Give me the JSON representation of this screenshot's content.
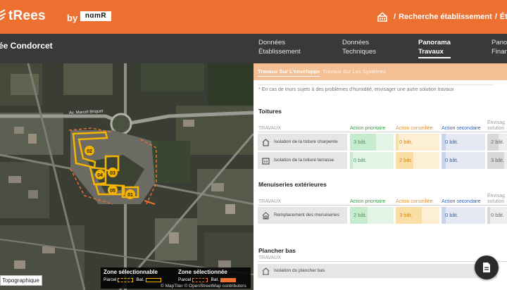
{
  "header": {
    "logo": "tRees",
    "by": "by",
    "partner": "nɑmR",
    "breadcrumb": [
      "Recherche établissement",
      "Établiss"
    ],
    "separators": [
      "/",
      "/"
    ]
  },
  "titlebar": {
    "title": "ée Condorcet",
    "tabs": [
      {
        "line1": "Données",
        "line2": "Établissement"
      },
      {
        "line1": "Données",
        "line2": "Techniques"
      },
      {
        "line1": "Panorama",
        "line2": "Travaux",
        "active": true
      },
      {
        "line1": "Panor",
        "line2": "Finan"
      }
    ]
  },
  "map": {
    "street_label": "Av. Marcel Briquet",
    "markers": [
      "02",
      "03",
      "04",
      "05",
      "01"
    ],
    "topo_button": "Topographique",
    "legend": {
      "selected_zone_1": {
        "title": "Zone sélectionnable",
        "parcel": "Parcel",
        "bat": "Bat."
      },
      "selected_zone_2": {
        "title": "Zone sélectionnée",
        "parcel": "Parcel",
        "bat": "Bat."
      }
    },
    "attribution": "© MapTiler © OpenStreetMap contributors",
    "colors": {
      "outline": "#f5b400",
      "selected": "#ec7030"
    }
  },
  "panel": {
    "subtabs": {
      "active": "Travaux Sur L'enveloppe",
      "inactive": "Travaux Sur Les Systèmes"
    },
    "note": "* En cas de murs sujets à des problèmes d'humidité, envisager une autre solution travaux",
    "columns": {
      "travaux": "TRAVAUX",
      "prioritaire": "Action prioritaire",
      "conseillee": "Action conseillée",
      "secondaire": "Action secondaire",
      "envisager": "Envisag",
      "envisager2": "solution"
    },
    "sections": [
      {
        "title": "Toitures",
        "rows": [
          {
            "label": "Isolation de la toiture charpente",
            "prio": "3 bât.",
            "cons": "0 bât.",
            "sec": "0 bât.",
            "env": "2 bât."
          },
          {
            "label": "Isolation de la toiture terrasse",
            "prio": "0 bât.",
            "cons": "2 bât.",
            "sec": "0 bât.",
            "env": "3 bât."
          }
        ]
      },
      {
        "title": "Menuiseries extérieures",
        "rows": [
          {
            "label": "Remplacement des menuiseries",
            "prio": "2 bât.",
            "cons": "3 bât.",
            "sec": "0 bât.",
            "env": "0 bât."
          }
        ]
      },
      {
        "title": "Plancher bas",
        "rows": [
          {
            "label": "Isolation du plancher bas"
          }
        ]
      }
    ],
    "fractions": {
      "s0r0": [
        0.6,
        0.0,
        0.1,
        0.4
      ],
      "s0r1": [
        0.0,
        0.4,
        0.1,
        0.6
      ],
      "s1r0": [
        0.4,
        0.6,
        0.1,
        0.0
      ]
    }
  },
  "colors": {
    "orange": "#ec7030",
    "dark": "#393939",
    "green": "#3c9a4c",
    "amber": "#e38f23",
    "blue": "#2f5fb8"
  }
}
